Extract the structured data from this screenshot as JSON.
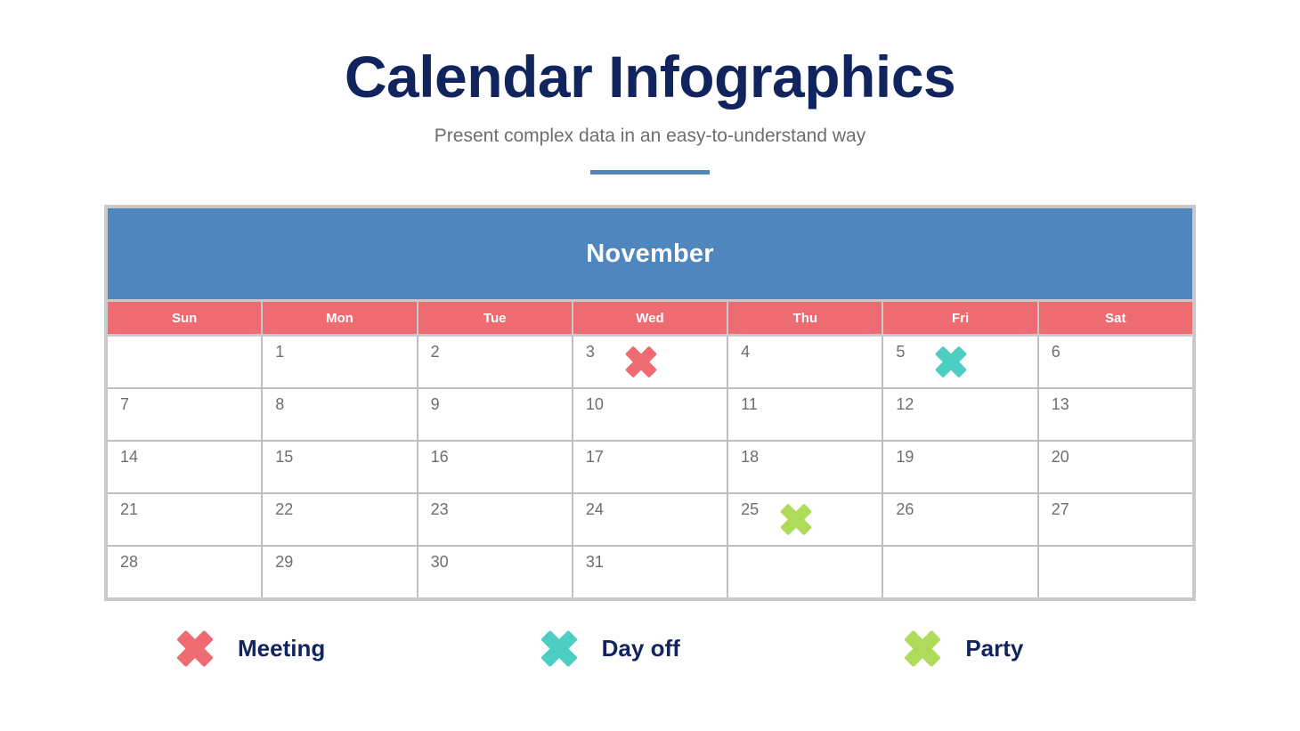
{
  "header": {
    "title": "Calendar Infographics",
    "subtitle": "Present complex data in an easy-to-understand way"
  },
  "calendar": {
    "month": "November",
    "weekdays": [
      "Sun",
      "Mon",
      "Tue",
      "Wed",
      "Thu",
      "Fri",
      "Sat"
    ],
    "weeks": [
      [
        {
          "day": "",
          "marker": null
        },
        {
          "day": "1",
          "marker": null
        },
        {
          "day": "2",
          "marker": null
        },
        {
          "day": "3",
          "marker": "meeting"
        },
        {
          "day": "4",
          "marker": null
        },
        {
          "day": "5",
          "marker": "day-off"
        },
        {
          "day": "6",
          "marker": null
        }
      ],
      [
        {
          "day": "7",
          "marker": null
        },
        {
          "day": "8",
          "marker": null
        },
        {
          "day": "9",
          "marker": null
        },
        {
          "day": "10",
          "marker": null
        },
        {
          "day": "11",
          "marker": null
        },
        {
          "day": "12",
          "marker": null
        },
        {
          "day": "13",
          "marker": null
        }
      ],
      [
        {
          "day": "14",
          "marker": null
        },
        {
          "day": "15",
          "marker": null
        },
        {
          "day": "16",
          "marker": null
        },
        {
          "day": "17",
          "marker": null
        },
        {
          "day": "18",
          "marker": null
        },
        {
          "day": "19",
          "marker": null
        },
        {
          "day": "20",
          "marker": null
        }
      ],
      [
        {
          "day": "21",
          "marker": null
        },
        {
          "day": "22",
          "marker": null
        },
        {
          "day": "23",
          "marker": null
        },
        {
          "day": "24",
          "marker": null
        },
        {
          "day": "25",
          "marker": "party"
        },
        {
          "day": "26",
          "marker": null
        },
        {
          "day": "27",
          "marker": null
        }
      ],
      [
        {
          "day": "28",
          "marker": null
        },
        {
          "day": "29",
          "marker": null
        },
        {
          "day": "30",
          "marker": null
        },
        {
          "day": "31",
          "marker": null
        },
        {
          "day": "",
          "marker": null
        },
        {
          "day": "",
          "marker": null
        },
        {
          "day": "",
          "marker": null
        }
      ]
    ]
  },
  "legend": [
    {
      "id": "meeting",
      "label": "Meeting",
      "color": "#EE6B72",
      "icon": "x-mark-icon"
    },
    {
      "id": "day-off",
      "label": "Day off",
      "color": "#4CCFC2",
      "icon": "x-mark-icon"
    },
    {
      "id": "party",
      "label": "Party",
      "color": "#AEDC5A",
      "icon": "x-mark-icon"
    }
  ],
  "colors": {
    "title": "#11245E",
    "subtitle": "#6E6E6E",
    "accent": "#4F86BD",
    "month_banner": "#4F86BD",
    "weekday_header": "#EE6B72",
    "grid_border": "#BFBFBF",
    "frame": "#C9C9C9",
    "day_number": "#6E6E6E"
  }
}
